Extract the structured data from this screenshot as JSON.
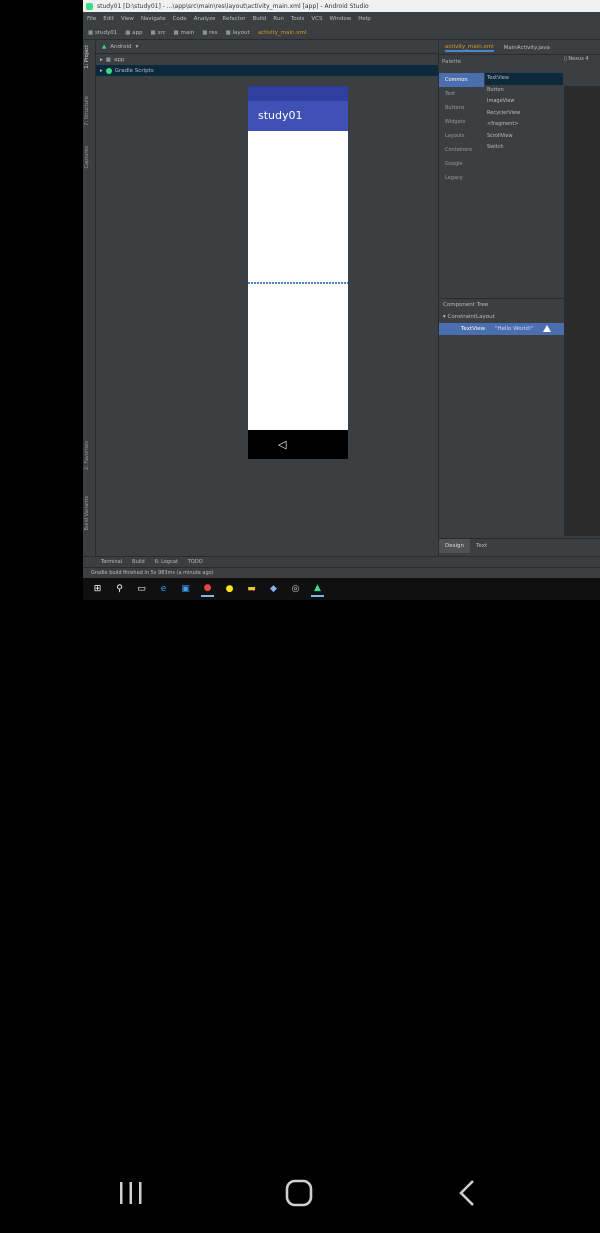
{
  "window": {
    "title": "study01 [D:\\study01] - ...\\app\\src\\main\\res\\layout\\activity_main.xml [app] - Android Studio"
  },
  "menu": [
    "File",
    "Edit",
    "View",
    "Navigate",
    "Code",
    "Analyze",
    "Refactor",
    "Build",
    "Run",
    "Tools",
    "VCS",
    "Window",
    "Help"
  ],
  "breadcrumb": [
    "study01",
    "app",
    "src",
    "main",
    "res",
    "layout",
    "activity_main.xml"
  ],
  "sidebar_tabs": {
    "project": "1: Project",
    "structure": "7: Structure",
    "captures": "Captures",
    "favorites": "2: Favorites",
    "build_variants": "Build Variants"
  },
  "project": {
    "view": "Android",
    "tree": [
      {
        "label": "app",
        "selected": false
      },
      {
        "label": "Gradle Scripts",
        "selected": true
      }
    ]
  },
  "editor": {
    "tabs": [
      {
        "label": "activity_main.xml",
        "active": true
      },
      {
        "label": "MainActivity.java",
        "active": false
      }
    ],
    "device": "Nexus 4",
    "palette": {
      "title": "Palette",
      "categories": [
        "Common",
        "Text",
        "Buttons",
        "Widgets",
        "Layouts",
        "Containers",
        "Google",
        "Legacy"
      ],
      "widgets": [
        "TextView",
        "Button",
        "ImageView",
        "RecyclerView",
        "<fragment>",
        "ScrollView",
        "Switch"
      ]
    },
    "component_tree": {
      "title": "Component Tree",
      "root": "ConstraintLayout",
      "child": "TextView",
      "child_text": "\"Hello World!\""
    },
    "preview": {
      "app_title": "study01",
      "back_glyph": "◁"
    },
    "mode_tabs": [
      {
        "label": "Design",
        "active": true
      },
      {
        "label": "Text",
        "active": false
      }
    ]
  },
  "bottom_tools": [
    "Terminal",
    "Build",
    "6: Logcat",
    "TODO"
  ],
  "status_text": "Gradle build finished in 5s 983ms (a minute ago)",
  "taskbar": [
    "windows-icon",
    "search-icon",
    "task-view-icon",
    "edge-icon",
    "store-icon",
    "chrome-icon",
    "kakaotalk-icon",
    "explorer-icon",
    "paint-icon",
    "obs-icon",
    "android-studio-icon"
  ]
}
